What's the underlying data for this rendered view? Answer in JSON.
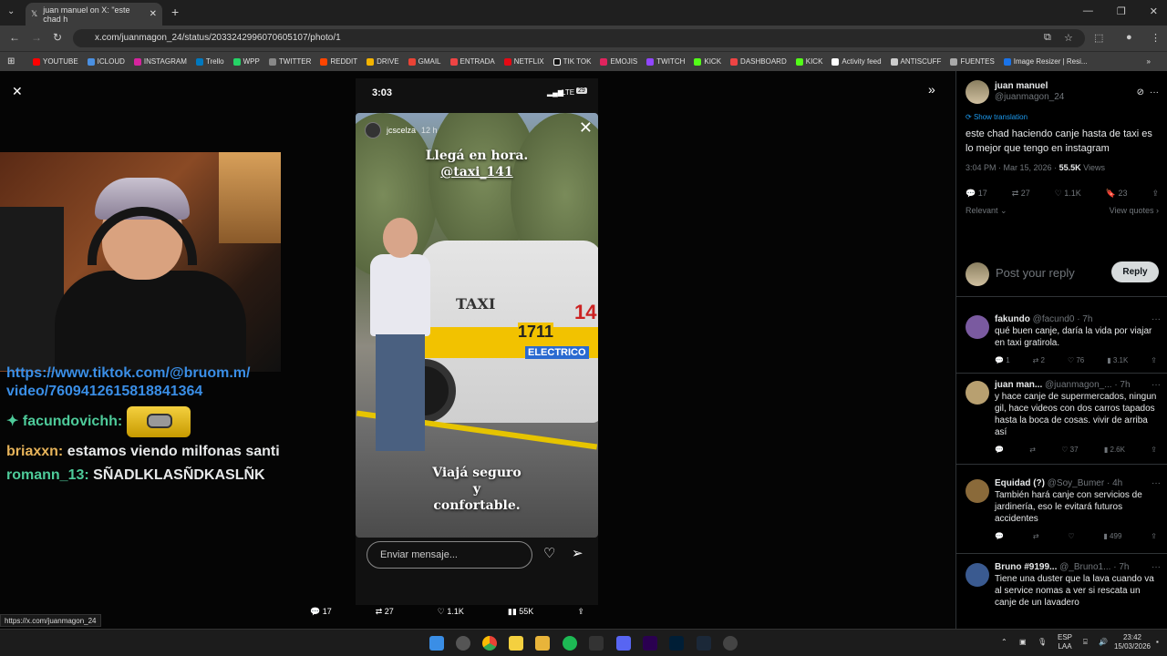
{
  "browser": {
    "tab_title": "juan manuel on X: \"este chad h",
    "url": "x.com/juanmagon_24/status/2033242996070605107/photo/1",
    "bookmarks": [
      "YOUTUBE",
      "ICLOUD",
      "INSTAGRAM",
      "Trello",
      "WPP",
      "TWITTER",
      "REDDIT",
      "DRIVE",
      "GMAIL",
      "ENTRADA",
      "NETFLIX",
      "TIK TOK",
      "EMOJIS",
      "TWITCH",
      "KICK",
      "DASHBOARD",
      "KICK",
      "Activity feed",
      "ANTISCUFF",
      "FUENTES",
      "Image Resizer | Resi..."
    ],
    "status_link": "https://x.com/juanmagon_24"
  },
  "chat": {
    "link_line1": "https://www.tiktok.com/@bruom.m/",
    "link_line2": "video/7609412615818841364",
    "msg1_user": "facundovichh:",
    "msg2_user": "briaxxn:",
    "msg2_text": "estamos viendo milfonas santi",
    "msg3_user": "romann_13:",
    "msg3_text": "SÑADLKLASÑDKASLÑK"
  },
  "story": {
    "time": "3:03",
    "network": "LTE",
    "battery": "29",
    "username": "jcscelza",
    "age": "12 h",
    "headline1": "Llegá en hora.",
    "headline2": "@taxi_141",
    "tagline1": "Viajá seguro",
    "tagline2": "y",
    "tagline3": "confortable.",
    "taxi_sign": "TAXI",
    "taxi_phone": "1711",
    "taxi_number": "14",
    "taxi_electric": "ELECTRICO",
    "input_placeholder": "Enviar mensaje..."
  },
  "bottom_actions": {
    "replies": "17",
    "reposts": "27",
    "likes": "1.1K",
    "views": "55K"
  },
  "tweet": {
    "author": "juan manuel",
    "handle": "@juanmagon_24",
    "show_translation": "Show translation",
    "text": "este chad haciendo canje hasta de taxi es lo mejor que tengo en instagram",
    "timestamp": "3:04 PM · Mar 15, 2026 ·",
    "views_count": "55.5K",
    "views_label": "Views",
    "replies": "17",
    "reposts": "27",
    "likes": "1.1K",
    "bookmarks": "23",
    "sort": "Relevant",
    "view_quotes": "View quotes",
    "reply_placeholder": "Post your reply",
    "reply_button": "Reply"
  },
  "replies": [
    {
      "name": "fakundo",
      "handle": "@facund0 · 7h",
      "text": "qué buen canje, daría la vida por viajar en taxi gratirola.",
      "r": "1",
      "rt": "2",
      "l": "76",
      "v": "3.1K",
      "color": "#7a5aa0"
    },
    {
      "name": "juan man...",
      "handle": "@juanmagon_... · 7h",
      "text": "y hace canje de supermercados, ningun gil, hace videos con dos carros tapados hasta la boca de cosas. vivir de arriba así",
      "r": "",
      "rt": "",
      "l": "37",
      "v": "2.6K",
      "color": "#b8a070"
    },
    {
      "name": "Equidad (?)",
      "handle": "@Soy_Bumer · 4h",
      "text": "También hará canje con servicios de jardinería, eso le evitará futuros accidentes",
      "r": "",
      "rt": "",
      "l": "",
      "v": "499",
      "color": "#8a6a3a"
    },
    {
      "name": "Bruno #9199...",
      "handle": "@_Bruno1... · 7h",
      "text": "Tiene una duster que la lava cuando va al service nomas a ver si rescata un canje de un lavadero",
      "r": "",
      "rt": "",
      "l": "",
      "v": "",
      "color": "#3a5a90"
    }
  ],
  "taskbar": {
    "lang1": "ESP",
    "lang2": "LAA",
    "time": "23:42",
    "date": "15/03/2026"
  }
}
